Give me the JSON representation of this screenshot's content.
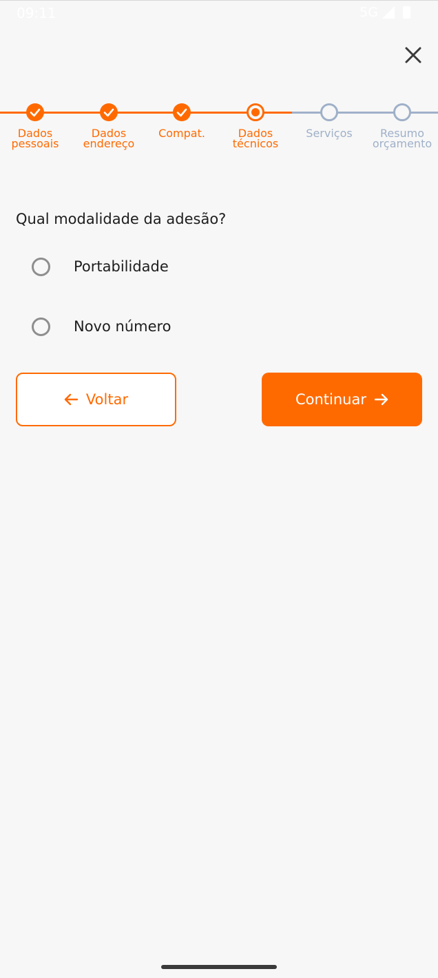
{
  "status_bar": {
    "time": "09:11",
    "network": "5G"
  },
  "colors": {
    "accent": "#ff6a00",
    "inactive": "#9fb0c8",
    "background": "#f7f7f7",
    "text": "#1d1d1d"
  },
  "stepper": {
    "steps": [
      {
        "label": "Dados pessoais",
        "state": "done"
      },
      {
        "label": "Dados endereço",
        "state": "done"
      },
      {
        "label": "Compat.",
        "state": "done"
      },
      {
        "label": "Dados técnicos",
        "state": "current"
      },
      {
        "label": "Serviços",
        "state": "todo"
      },
      {
        "label": "Resumo orçamento",
        "state": "todo"
      }
    ]
  },
  "form": {
    "question": "Qual modalidade da adesão?",
    "options": [
      {
        "label": "Portabilidade",
        "selected": false
      },
      {
        "label": "Novo número",
        "selected": false
      }
    ]
  },
  "buttons": {
    "back_label": "Voltar",
    "continue_label": "Continuar"
  },
  "icons": {
    "close": "close-icon",
    "back": "arrow-left-icon",
    "next": "arrow-right-icon"
  }
}
